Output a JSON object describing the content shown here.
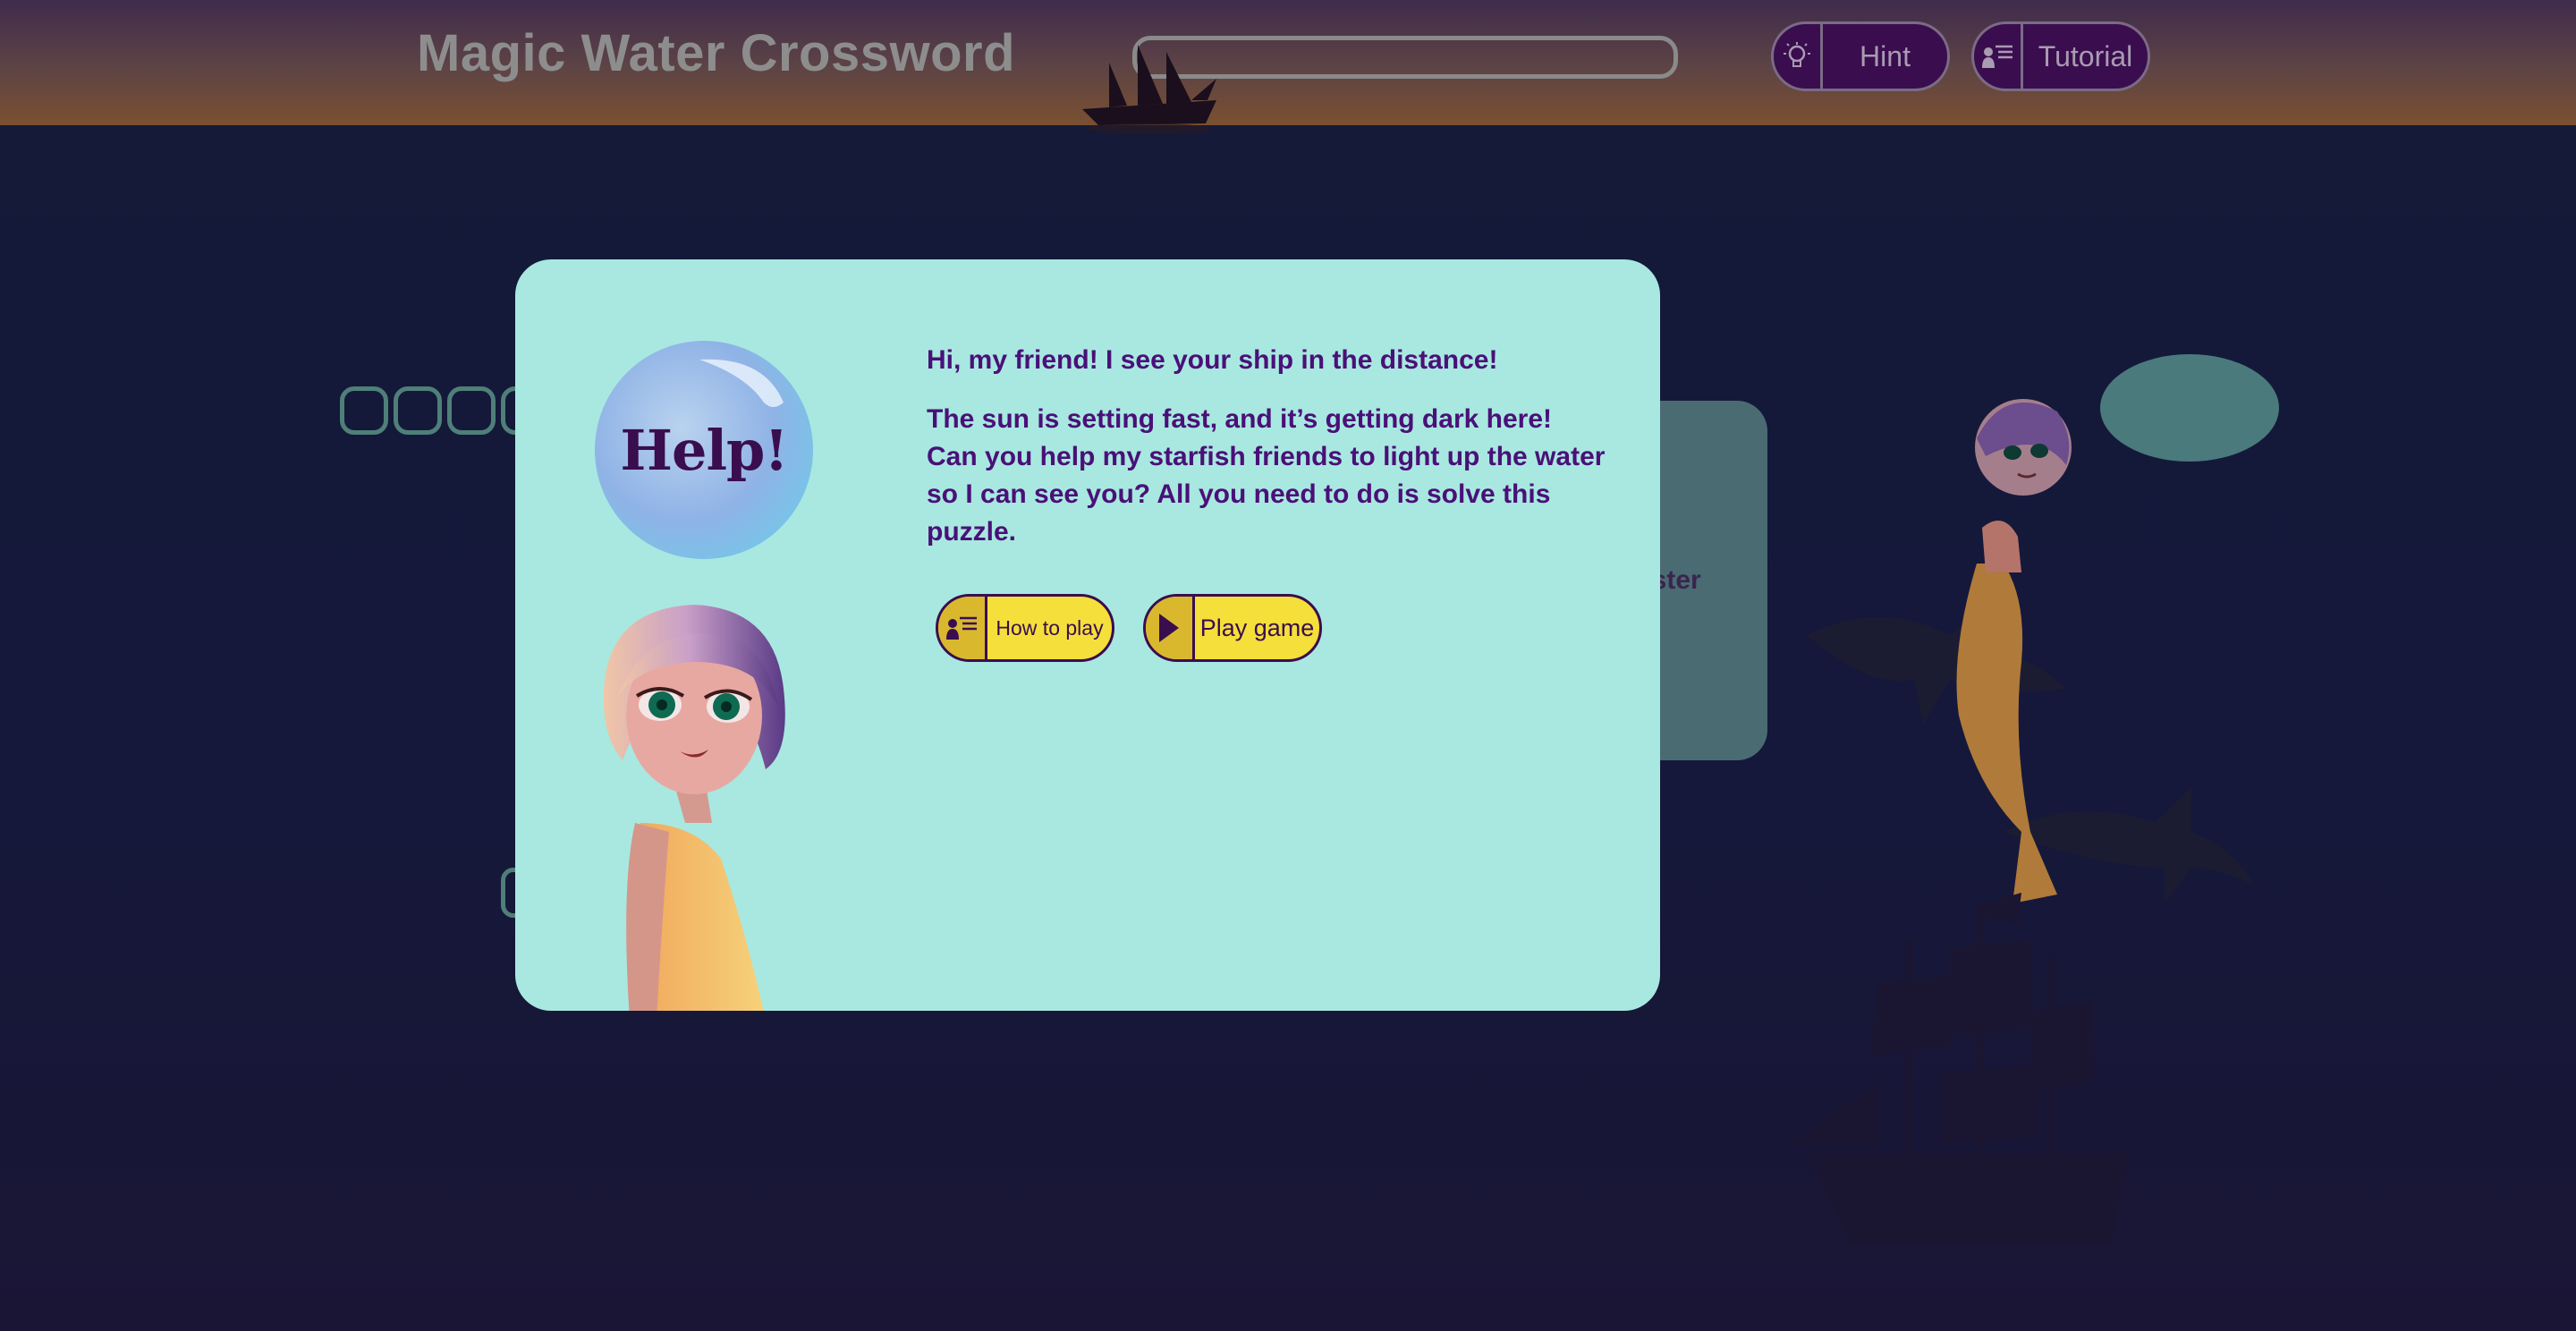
{
  "header": {
    "title": "Magic Water Crossword",
    "progress": 0,
    "buttons": {
      "hint_label": "Hint",
      "hint_icon": "lightbulb-icon",
      "tutorial_label": "Tutorial",
      "tutorial_icon": "presenter-board-icon"
    }
  },
  "background": {
    "card_text": "aster"
  },
  "dialog": {
    "bubble_text": "Help!",
    "paragraphs": [
      "Hi, my friend! I see your ship in the distance!",
      "The sun is setting fast, and it’s getting dark here! Can you help my starfish friends to light up the water so I can see you? All you need to do is solve this puzzle."
    ],
    "buttons": {
      "how_to_play_label": "How to play",
      "how_to_play_icon": "presenter-board-icon",
      "play_game_label": "Play game",
      "play_game_icon": "play-triangle-icon"
    }
  },
  "colors": {
    "dialog_bg": "#a8e8e0",
    "text_purple": "#4a1078",
    "button_yellow": "#f5df3a",
    "header_button_bg": "#3a0d4e"
  }
}
